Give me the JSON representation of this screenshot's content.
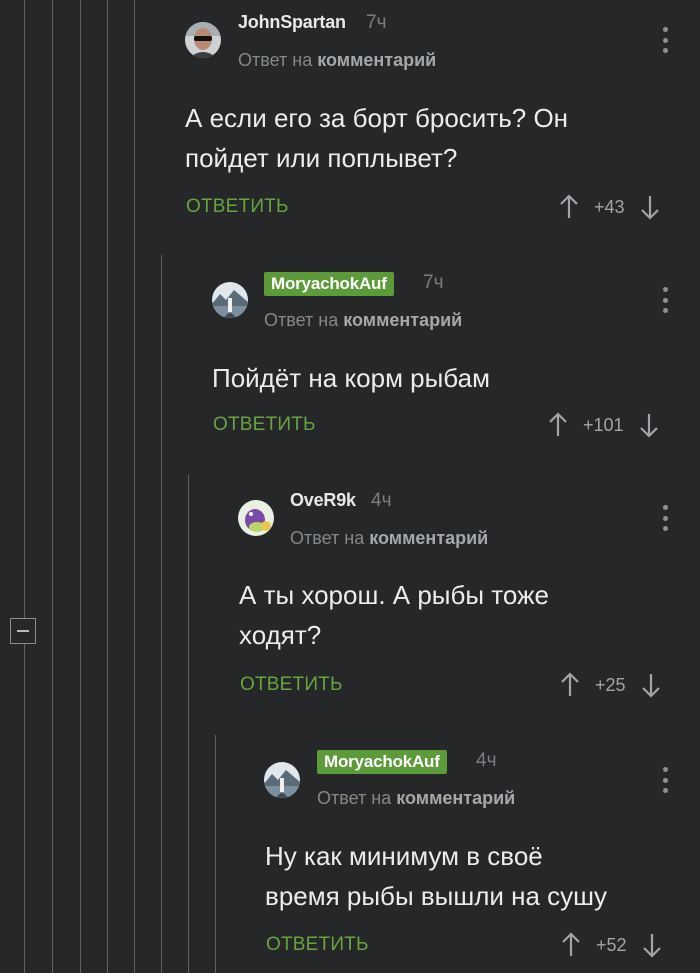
{
  "comments": [
    {
      "author": "JohnSpartan",
      "time": "7ч",
      "reply_prefix": "Ответ на",
      "reply_target": "комментарий",
      "text_lines": [
        "А если его за борт бросить? Он",
        "пойдет или поплывет?"
      ],
      "reply_label": "ОТВЕТИТЬ",
      "rating": "+43",
      "avatar": "man-with-sunglasses-avatar"
    },
    {
      "author": "MoryachokAuf",
      "time": "7ч",
      "reply_prefix": "Ответ на",
      "reply_target": "комментарий",
      "text_lines": [
        "Пойдёт на корм рыбам"
      ],
      "reply_label": "ОТВЕТИТЬ",
      "rating": "+101",
      "avatar": "sea-lighthouse-avatar",
      "author_is_op": true
    },
    {
      "author": "OveR9k",
      "time": "4ч",
      "reply_prefix": "Ответ на",
      "reply_target": "комментарий",
      "text_lines": [
        "А ты хорош. А рыбы тоже",
        "ходят?"
      ],
      "reply_label": "ОТВЕТИТЬ",
      "rating": "+25",
      "avatar": "purple-dinosaur-avatar"
    },
    {
      "author": "MoryachokAuf",
      "time": "4ч",
      "reply_prefix": "Ответ на",
      "reply_target": "комментарий",
      "text_lines": [
        "Ну как минимум в своё",
        "время рыбы вышли на сушу"
      ],
      "reply_label": "ОТВЕТИТЬ",
      "rating": "+52",
      "avatar": "sea-lighthouse-avatar",
      "author_is_op": true
    }
  ],
  "colors": {
    "background": "#252729",
    "accent_green": "#67a43f",
    "op_badge": "#5d9a39",
    "thread_line": "#5f6264"
  },
  "icons": [
    "collapse-minus-icon",
    "more-vertical-icon",
    "arrow-up-icon",
    "arrow-down-icon"
  ]
}
